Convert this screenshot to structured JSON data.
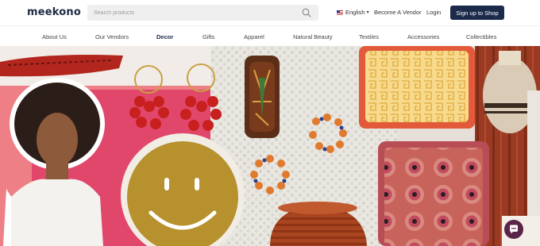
{
  "brand": {
    "logo_text": "meekono"
  },
  "search": {
    "placeholder": "Search products"
  },
  "header": {
    "language": "English",
    "become_vendor": "Become A Vendor",
    "login": "Login",
    "signup": "Sign up to Shop"
  },
  "nav": {
    "items": [
      {
        "label": "About Us"
      },
      {
        "label": "Our Vendors"
      },
      {
        "label": "Decor"
      },
      {
        "label": "Gifts"
      },
      {
        "label": "Apparel"
      },
      {
        "label": "Natural Beauty"
      },
      {
        "label": "Textiles"
      },
      {
        "label": "Accessories"
      },
      {
        "label": "Collectibles"
      }
    ],
    "active": "Decor"
  },
  "icons": {
    "search": "search-icon",
    "language_flag": "us-flag-icon",
    "chevron": "chevron-down-icon",
    "chat": "chat-bubble-icon"
  },
  "colors": {
    "brand_navy": "#1b2a4a",
    "chat_button": "#5a2448"
  }
}
